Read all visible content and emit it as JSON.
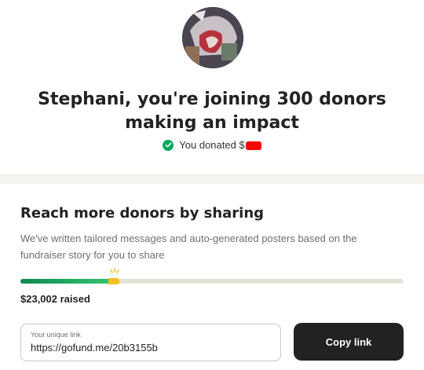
{
  "header": {
    "headline_line1": "Stephani, you're joining 300 donors",
    "headline_line2": "making an impact",
    "donated_text": "You donated $"
  },
  "share": {
    "title": "Reach more donors by sharing",
    "description": "We've written tailored messages and auto-generated posters based on the fundraiser story for you to share",
    "progress_fraction": 0.25,
    "raised_text": "$23,002 raised",
    "link_label": "Your unique link",
    "link_value": "https://gofund.me/20b3155b",
    "copy_label": "Copy link"
  },
  "colors": {
    "brand_green": "#02a95c",
    "button_dark": "#222222",
    "marker_yellow": "#f7c021",
    "band": "#f4f2ec"
  }
}
